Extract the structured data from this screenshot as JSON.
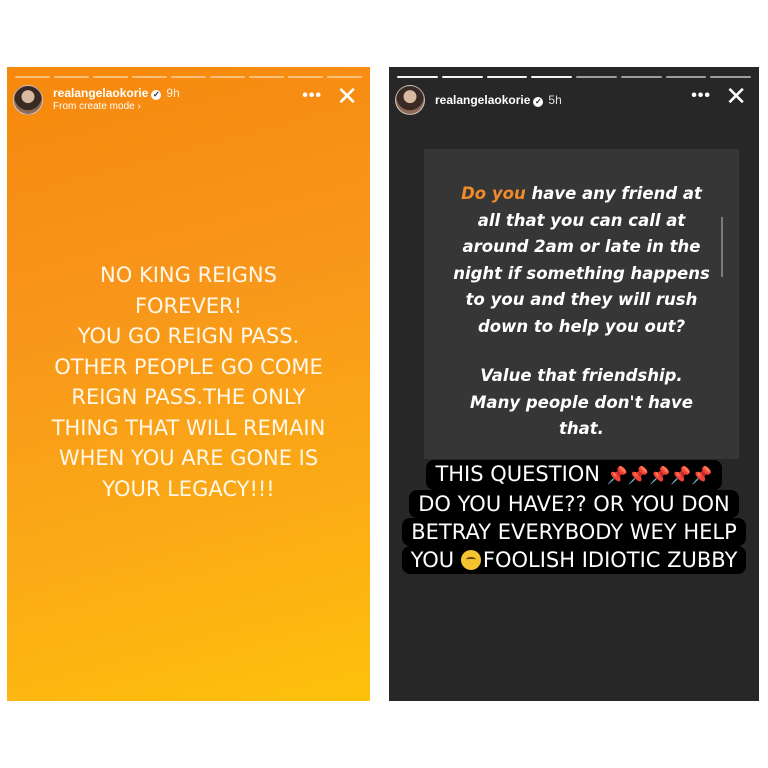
{
  "stories": [
    {
      "username": "realangelaokorie",
      "time": "9h",
      "subtitle": "From create mode ›",
      "more_icon": "more-horizontal-icon",
      "close_icon": "close-icon",
      "lines": [
        "NO KING REIGNS",
        "FOREVER!",
        "YOU GO REIGN PASS.",
        "OTHER PEOPLE GO COME",
        "REIGN PASS.THE ONLY",
        "THING THAT WILL REMAIN",
        "WHEN YOU ARE GONE IS",
        "YOUR LEGACY!!!"
      ]
    },
    {
      "username": "realangelaokorie",
      "time": "5h",
      "more_icon": "more-horizontal-icon",
      "close_icon": "close-icon",
      "card": {
        "accent": "Do you",
        "line1_rest": " have any friend at",
        "lines": [
          "all that you can call at",
          "around 2am or late in the",
          "night if something happens",
          "to you and they will rush",
          "down to help you out?"
        ],
        "lines2": [
          "Value that friendship.",
          "Many people don't have",
          "that."
        ]
      },
      "caption": {
        "line1": "THIS QUESTION",
        "pins": "📌📌📌📌📌",
        "line2": "DO YOU HAVE?? OR YOU DON",
        "line3": "BETRAY EVERYBODY WEY HELP",
        "line4_a": "YOU",
        "line4_b": "FOOLISH IDIOTIC ZUBBY"
      }
    }
  ],
  "colors": {
    "accent_orange": "#f08a2b",
    "left_bg_top": "#f6880d",
    "left_bg_bottom": "#ffc10c",
    "right_bg": "#272727"
  }
}
